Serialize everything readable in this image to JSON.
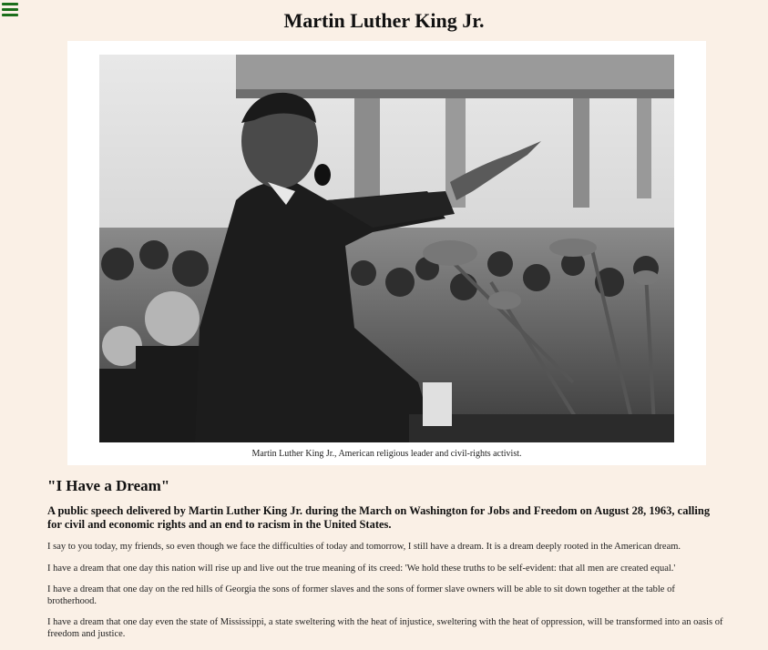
{
  "menu": {
    "icon": "hamburger-menu-icon",
    "color": "#1a6e1a"
  },
  "page": {
    "title": "Martin Luther King Jr.",
    "background": "#faf0e6"
  },
  "figure": {
    "image_subject": "photo-of-speaker-at-microphones",
    "caption": "Martin Luther King Jr., American religious leader and civil-rights activist."
  },
  "speech": {
    "title": "\"I Have a Dream\"",
    "summary": "A public speech delivered by Martin Luther King Jr. during the March on Washington for Jobs and Freedom on August 28, 1963, calling for civil and economic rights and an end to racism in the United States.",
    "paragraphs": [
      "I say to you today, my friends, so even though we face the difficulties of today and tomorrow, I still have a dream. It is a dream deeply rooted in the American dream.",
      "I have a dream that one day this nation will rise up and live out the true meaning of its creed: 'We hold these truths to be self-evident: that all men are created equal.'",
      "I have a dream that one day on the red hills of Georgia the sons of former slaves and the sons of former slave owners will be able to sit down together at the table of brotherhood.",
      "I have a dream that one day even the state of Mississippi, a state sweltering with the heat of injustice, sweltering with the heat of oppression, will be transformed into an oasis of freedom and justice."
    ]
  }
}
